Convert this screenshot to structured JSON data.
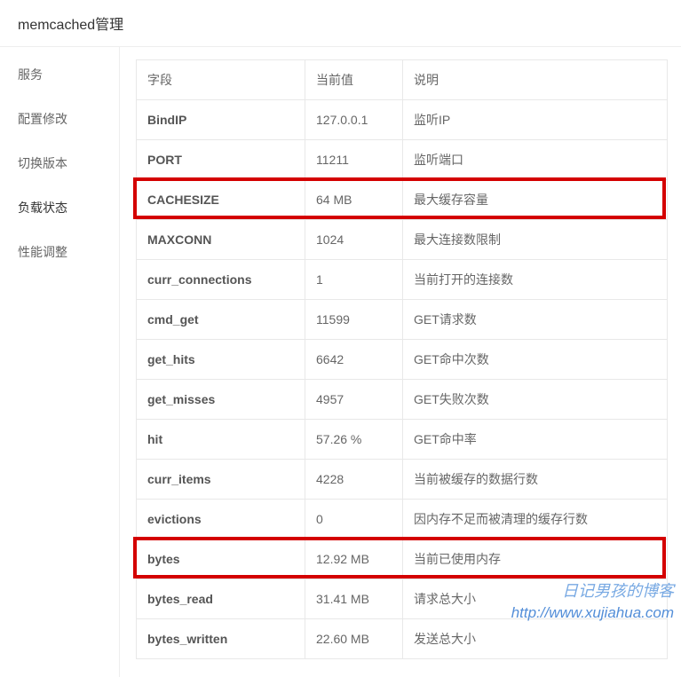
{
  "header": {
    "title": "memcached管理"
  },
  "sidebar": {
    "items": [
      {
        "label": "服务",
        "active": false
      },
      {
        "label": "配置修改",
        "active": false
      },
      {
        "label": "切换版本",
        "active": false
      },
      {
        "label": "负载状态",
        "active": true
      },
      {
        "label": "性能调整",
        "active": false
      }
    ]
  },
  "table": {
    "headers": {
      "field": "字段",
      "value": "当前值",
      "desc": "说明"
    },
    "rows": [
      {
        "field": "BindIP",
        "value": "127.0.0.1",
        "desc": "监听IP",
        "highlight": false
      },
      {
        "field": "PORT",
        "value": "11211",
        "desc": "监听端口",
        "highlight": false
      },
      {
        "field": "CACHESIZE",
        "value": "64 MB",
        "desc": "最大缓存容量",
        "highlight": true
      },
      {
        "field": "MAXCONN",
        "value": "1024",
        "desc": "最大连接数限制",
        "highlight": false
      },
      {
        "field": "curr_connections",
        "value": "1",
        "desc": "当前打开的连接数",
        "highlight": false
      },
      {
        "field": "cmd_get",
        "value": "11599",
        "desc": "GET请求数",
        "highlight": false
      },
      {
        "field": "get_hits",
        "value": "6642",
        "desc": "GET命中次数",
        "highlight": false
      },
      {
        "field": "get_misses",
        "value": "4957",
        "desc": "GET失败次数",
        "highlight": false
      },
      {
        "field": "hit",
        "value": "57.26 %",
        "desc": "GET命中率",
        "highlight": false
      },
      {
        "field": "curr_items",
        "value": "4228",
        "desc": "当前被缓存的数据行数",
        "highlight": false
      },
      {
        "field": "evictions",
        "value": "0",
        "desc": "因内存不足而被清理的缓存行数",
        "highlight": false
      },
      {
        "field": "bytes",
        "value": "12.92 MB",
        "desc": "当前已使用内存",
        "highlight": true
      },
      {
        "field": "bytes_read",
        "value": "31.41 MB",
        "desc": "请求总大小",
        "highlight": false
      },
      {
        "field": "bytes_written",
        "value": "22.60 MB",
        "desc": "发送总大小",
        "highlight": false
      }
    ]
  },
  "watermark": {
    "line1": "日记男孩的博客",
    "line2": "http://www.xujiahua.com"
  }
}
